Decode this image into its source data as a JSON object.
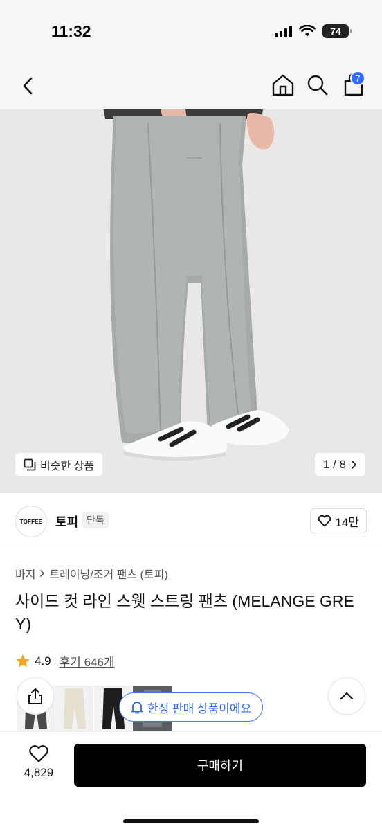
{
  "status_bar": {
    "time": "11:32",
    "battery": "74"
  },
  "nav": {
    "cart_badge": "7"
  },
  "image": {
    "similar_label": "비슷한 상품",
    "pager": "1 / 8"
  },
  "brand": {
    "logo_text": "TOFFEE",
    "name": "토피",
    "tag": "단독",
    "likes": "14만"
  },
  "breadcrumb": {
    "level1": "바지",
    "level2": "트레이닝/조거 팬츠 (토피)"
  },
  "product": {
    "title": "사이드 컷 라인 스웻 스트링 팬츠 (MELANGE GREY)",
    "rating": "4.9",
    "reviews": "후기 646개"
  },
  "floating": {
    "limited_label": "한정 판매 상품이에요"
  },
  "bottom": {
    "wish_count": "4,829",
    "buy_label": "구매하기"
  },
  "colors": {
    "accent_blue": "#2f6bff",
    "star": "#f5a623",
    "buy_button": "#000000"
  }
}
